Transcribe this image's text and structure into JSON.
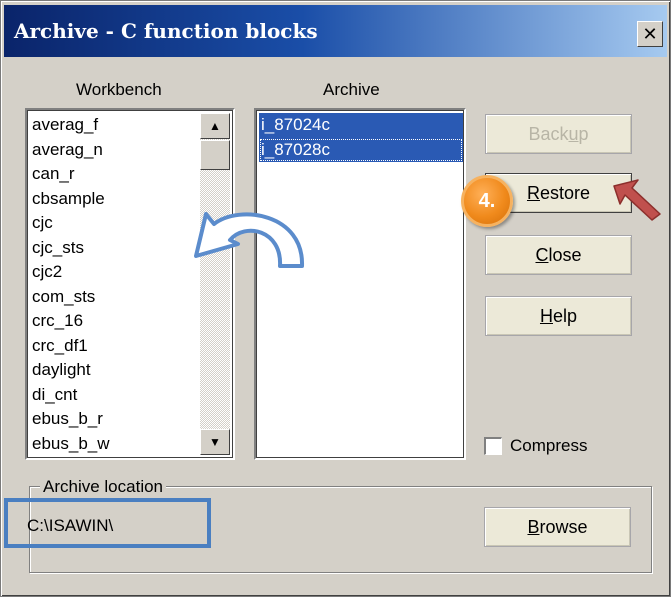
{
  "window": {
    "title": "Archive - C function blocks",
    "close_glyph": "✕"
  },
  "workbench": {
    "label": "Workbench",
    "items": [
      "averag_f",
      "averag_n",
      "can_r",
      "cbsample",
      "cjc",
      "cjc_sts",
      "cjc2",
      "com_sts",
      "crc_16",
      "crc_df1",
      "daylight",
      "di_cnt",
      "ebus_b_r",
      "ebus_b_w"
    ],
    "scroll_up": "▲",
    "scroll_down": "▼"
  },
  "archive": {
    "label": "Archive",
    "items": [
      "i_87024c",
      "i_87028c"
    ],
    "selected": [
      "i_87024c",
      "i_87028c"
    ]
  },
  "buttons": {
    "backup": {
      "pre": "Back",
      "accel": "u",
      "post": "p",
      "enabled": false
    },
    "restore": {
      "pre": "",
      "accel": "R",
      "post": "estore",
      "enabled": true
    },
    "close": {
      "pre": "",
      "accel": "C",
      "post": "lose",
      "enabled": true
    },
    "help": {
      "pre": "",
      "accel": "H",
      "post": "elp",
      "enabled": true
    },
    "browse": {
      "pre": "",
      "accel": "B",
      "post": "rowse",
      "enabled": true
    }
  },
  "compress": {
    "label": "Compress",
    "checked": false
  },
  "archive_location": {
    "label": "Archive location",
    "path": "C:\\ISAWIN\\"
  },
  "annotations": {
    "step_badge": "4.",
    "colors": {
      "badge": "#f08a1c",
      "arrow": "#5b8ccc",
      "pointer": "#c0504d",
      "highlight": "#4a7fc1"
    }
  }
}
